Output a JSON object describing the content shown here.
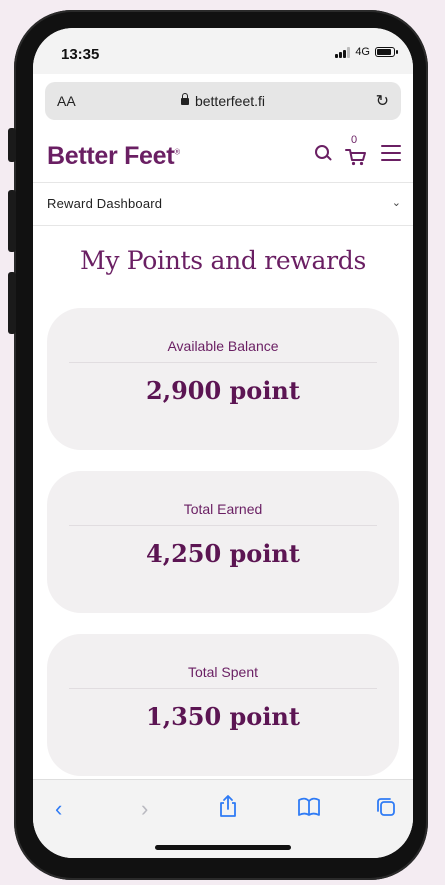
{
  "status_bar": {
    "time": "13:35",
    "network": "4G"
  },
  "browser": {
    "text_size": "AA",
    "url": "betterfeet.fi"
  },
  "header": {
    "logo": "Better Feet",
    "logo_mark": "®",
    "cart_count": "0"
  },
  "dashboard_menu": {
    "label": "Reward Dashboard"
  },
  "page": {
    "title": "My Points and rewards",
    "cards": [
      {
        "label": "Available Balance",
        "value": "2,900 point"
      },
      {
        "label": "Total Earned",
        "value": "4,250 point"
      },
      {
        "label": "Total Spent",
        "value": "1,350 point"
      }
    ]
  },
  "colors": {
    "brand": "#6a1f63",
    "card_bg": "#f2f0f1",
    "safari_blue": "#2f7bf5"
  }
}
